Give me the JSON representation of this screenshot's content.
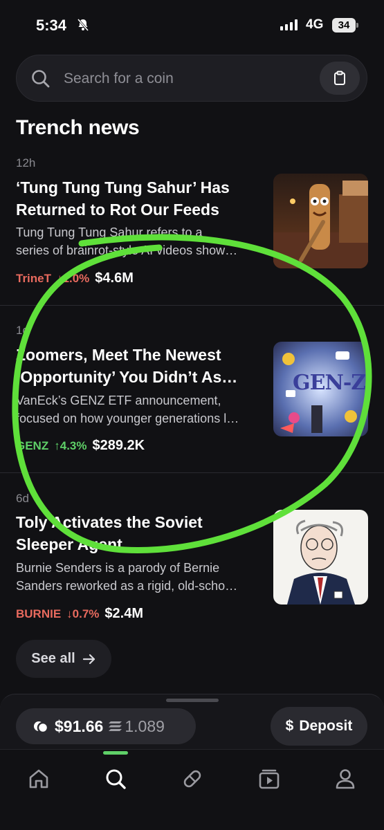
{
  "status_bar": {
    "time": "5:34",
    "network": "4G",
    "battery": "34"
  },
  "search": {
    "placeholder": "Search for a coin"
  },
  "section": {
    "title": "Trench news"
  },
  "news": [
    {
      "age": "12h",
      "title": "‘Tung Tung Tung Sahur’ Has Returned to Rot Our Feeds",
      "title_line1": "‘Tung Tung Tung Sahur’ Has",
      "title_line2": "Returned to Rot Our Feeds",
      "desc_line1": "Tung Tung Tung Sahur refers to a",
      "desc_line2": "series of brainrot-style AI videos show…",
      "ticker": "TrineT",
      "change": "↓1.0%",
      "change_direction": "down",
      "market_cap": "$4.6M"
    },
    {
      "age": "1d",
      "title_line1": "Zoomers, Meet The Newest",
      "title_line2": "‘Opportunity’ You Didn’t As…",
      "desc_line1": "VanEck’s GENZ ETF announcement,",
      "desc_line2": "focused on how younger generations l…",
      "ticker": "GENZ",
      "change": "↑4.3%",
      "change_direction": "up",
      "market_cap": "$289.2K",
      "image_text": "GEN-Z"
    },
    {
      "age": "6d",
      "title_line1": "Toly Activates the Soviet",
      "title_line2": "Sleeper Agent",
      "desc_line1": "Burnie Senders is a parody of Bernie",
      "desc_line2": "Sanders reworked as a rigid, old-scho…",
      "ticker": "BURNIE",
      "change": "↓0.7%",
      "change_direction": "down",
      "market_cap": "$2.4M"
    }
  ],
  "see_all": {
    "label": "See all"
  },
  "wallet": {
    "usd_balance": "$91.66",
    "sol_balance": "1.089"
  },
  "deposit": {
    "label": "Deposit",
    "symbol": "$"
  },
  "tabs": [
    "home-icon",
    "search-icon",
    "pill-icon",
    "video-icon",
    "profile-icon"
  ],
  "colors": {
    "negative": "#e86a5e",
    "positive": "#5fd068",
    "annotation": "#5fe03a"
  }
}
